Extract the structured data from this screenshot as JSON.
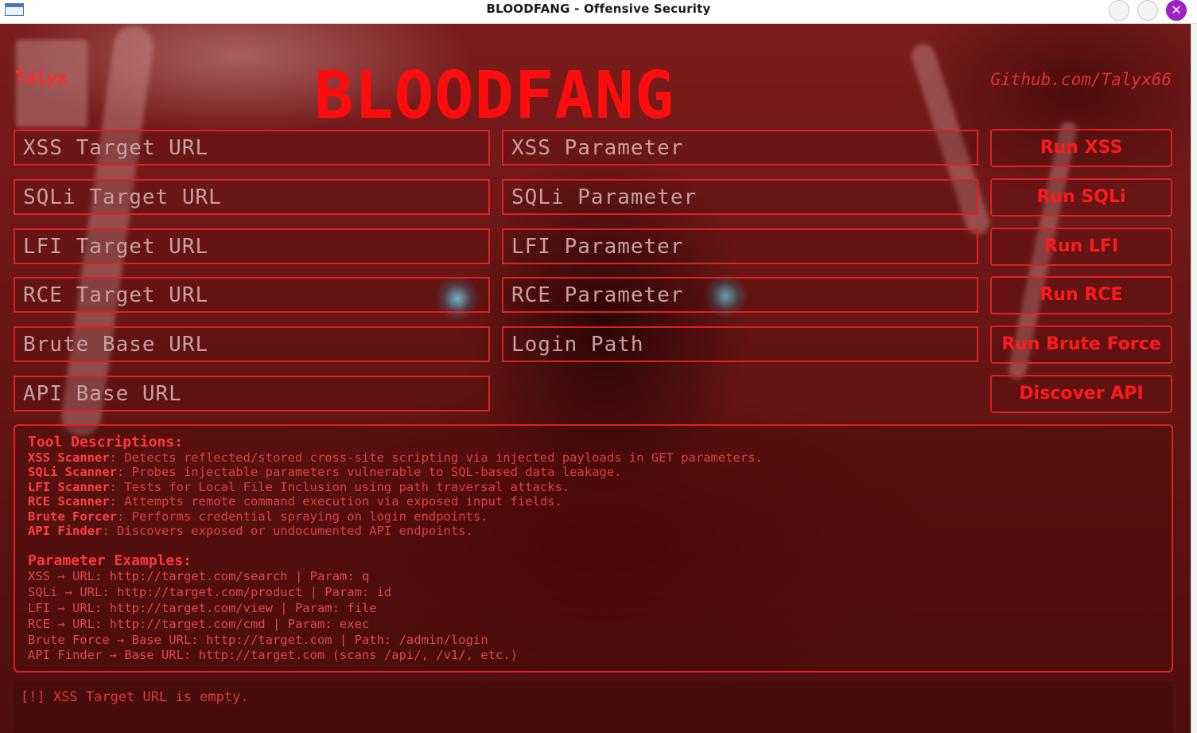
{
  "window": {
    "title": "BLOODFANG - Offensive Security",
    "close_glyph": "✕"
  },
  "header": {
    "author": "Talyx",
    "title": "BLOODFANG",
    "link": "Github.com/Talyx66"
  },
  "fields": {
    "xss_url": "XSS Target URL",
    "xss_param": "XSS Parameter",
    "sqli_url": "SQLi Target URL",
    "sqli_param": "SQLi Parameter",
    "lfi_url": "LFI Target URL",
    "lfi_param": "LFI Parameter",
    "rce_url": "RCE Target URL",
    "rce_param": "RCE Parameter",
    "brute_url": "Brute Base URL",
    "login_path": "Login Path",
    "api_url": "API Base URL"
  },
  "buttons": {
    "run_xss": "Run XSS",
    "run_sqli": "Run SQLi",
    "run_lfi": "Run LFI",
    "run_rce": "Run RCE",
    "run_brute": "Run Brute Force",
    "discover_api": "Discover API"
  },
  "descriptions": {
    "heading": "Tool Descriptions:",
    "items": [
      {
        "name": "XSS Scanner",
        "text": ": Detects reflected/stored cross-site scripting via injected payloads in GET parameters."
      },
      {
        "name": "SQLi Scanner",
        "text": ": Probes injectable parameters vulnerable to SQL-based data leakage."
      },
      {
        "name": "LFI Scanner",
        "text": ": Tests for Local File Inclusion using path traversal attacks."
      },
      {
        "name": "RCE Scanner",
        "text": ": Attempts remote command execution via exposed input fields."
      },
      {
        "name": "Brute Forcer",
        "text": ": Performs credential spraying on login endpoints."
      },
      {
        "name": "API Finder",
        "text": ": Discovers exposed or undocumented API endpoints."
      }
    ]
  },
  "examples": {
    "heading": "Parameter Examples:",
    "lines": [
      "XSS → URL: http://target.com/search | Param: q",
      "SQLi → URL: http://target.com/product | Param: id",
      "LFI → URL: http://target.com/view | Param: file",
      "RCE → URL: http://target.com/cmd | Param: exec",
      "Brute Force → Base URL: http://target.com | Path: /admin/login",
      "API Finder → Base URL: http://target.com (scans /api/, /v1/, etc.)"
    ]
  },
  "status": {
    "message": "[!] XSS Target URL is empty."
  },
  "colors": {
    "accent": "#ff0d0d",
    "border": "#e02020",
    "background": "#6a1616"
  }
}
